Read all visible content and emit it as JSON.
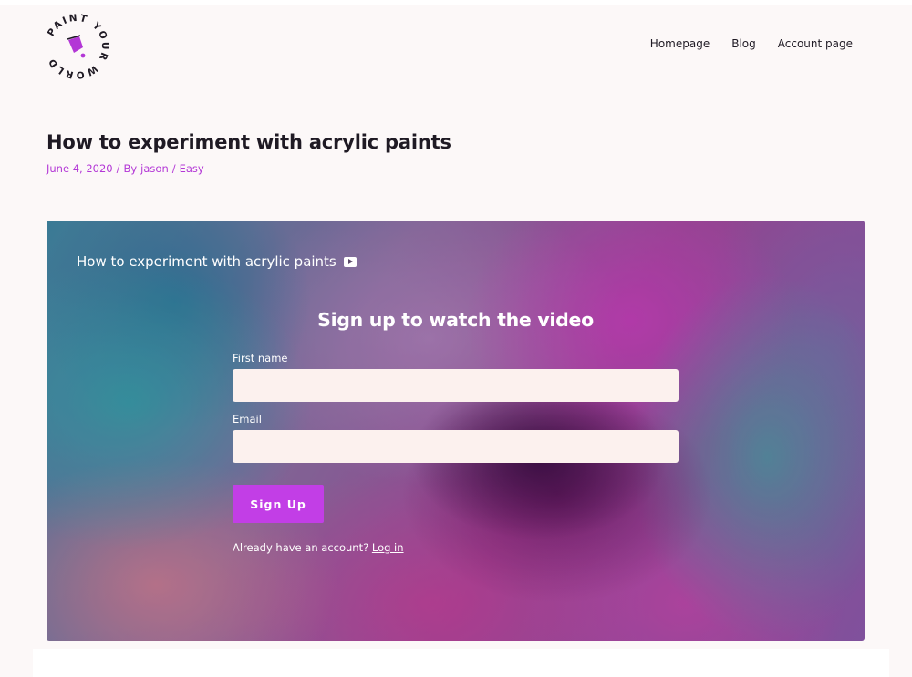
{
  "brand": {
    "logo_text": "PAINT YOUR WORLD",
    "accent": "#b337d6",
    "button_color": "#c23ee6"
  },
  "nav": {
    "items": [
      {
        "label": "Homepage"
      },
      {
        "label": "Blog"
      },
      {
        "label": "Account page"
      }
    ]
  },
  "post": {
    "title": "How to experiment with acrylic paints",
    "date": "June 4, 2020",
    "sep1": "/",
    "by": "By",
    "author": "jason",
    "sep2": "/",
    "category": "Easy"
  },
  "video": {
    "title": "How to experiment with acrylic paints",
    "icon": "youtube-icon"
  },
  "signup": {
    "heading": "Sign up to watch the video",
    "first_name_label": "First name",
    "first_name_value": "",
    "email_label": "Email",
    "email_value": "",
    "button_label": "Sign Up",
    "already_text": "Already have an account?",
    "login_link": "Log in"
  }
}
